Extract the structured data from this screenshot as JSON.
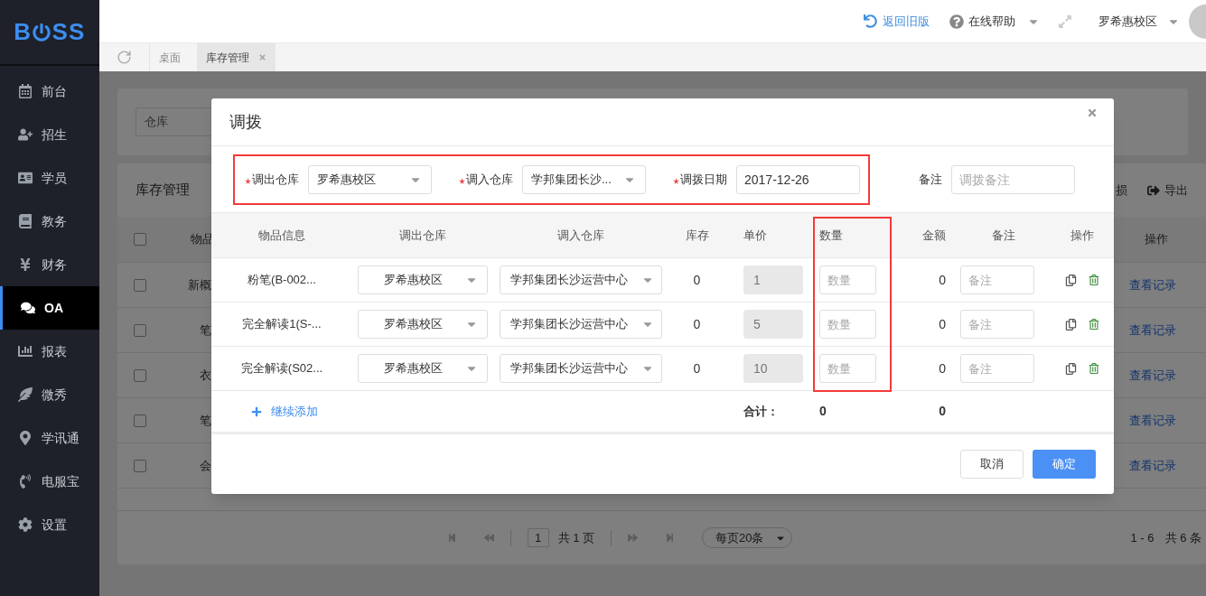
{
  "logo": {
    "before": "B",
    "after": "SS"
  },
  "sidebar": {
    "items": [
      {
        "label": "前台",
        "selected": false
      },
      {
        "label": "招生",
        "selected": false
      },
      {
        "label": "学员",
        "selected": false
      },
      {
        "label": "教务",
        "selected": false
      },
      {
        "label": "财务",
        "selected": false
      },
      {
        "label": "OA",
        "selected": true
      },
      {
        "label": "报表",
        "selected": false
      },
      {
        "label": "微秀",
        "selected": false
      },
      {
        "label": "学讯通",
        "selected": false
      },
      {
        "label": "电服宝",
        "selected": false
      },
      {
        "label": "设置",
        "selected": false
      }
    ]
  },
  "header": {
    "back_link": "返回旧版",
    "help": "在线帮助",
    "campus": "罗希惠校区"
  },
  "tabs": [
    {
      "label": "桌面",
      "selected": false,
      "closable": false
    },
    {
      "label": "库存管理",
      "selected": true,
      "closable": true
    }
  ],
  "filter": {
    "warehouse_placeholder": "仓库"
  },
  "inventory": {
    "title": "库存管理",
    "actions": [
      "损",
      "导出"
    ],
    "columns": [
      "物品",
      "操作"
    ],
    "all_checked": false,
    "rows": [
      {
        "checked": false,
        "name": "新概",
        "link": "查看记录"
      },
      {
        "checked": false,
        "name": "笔",
        "link": "查看记录"
      },
      {
        "checked": false,
        "name": "衣",
        "link": "查看记录"
      },
      {
        "checked": false,
        "name": "笔",
        "link": "查看记录"
      },
      {
        "checked": false,
        "name": "会",
        "link": "查看记录"
      }
    ],
    "pagination": {
      "page": "1",
      "pages": "共 1 页",
      "page_size": "每页20条",
      "range": "1 - 6",
      "total": "共 6 条"
    }
  },
  "dialog": {
    "title": "调拨",
    "form": {
      "highlighted": true,
      "fields": [
        {
          "kind": "select",
          "label": "调出仓库",
          "required": true,
          "value": "罗希惠校区"
        },
        {
          "kind": "select",
          "label": "调入仓库",
          "required": true,
          "value": "学邦集团长沙..."
        },
        {
          "kind": "input",
          "label": "调拨日期",
          "required": true,
          "value": "2017-12-26"
        },
        {
          "kind": "input",
          "label": "备注",
          "required": false,
          "placeholder": "调拨备注"
        }
      ]
    },
    "columns": [
      "物品信息",
      "调出仓库",
      "调入仓库",
      "库存",
      "单价",
      "数量",
      "金额",
      "备注",
      "操作"
    ],
    "quantity_column_highlighted": true,
    "rows": [
      {
        "item": "粉笔(B-002...",
        "from": "罗希惠校区",
        "to": "学邦集团长沙运营中心",
        "stock": "0",
        "price": "1",
        "price_disabled": true,
        "qty_placeholder": "数量",
        "amount": "0",
        "note_placeholder": "备注"
      },
      {
        "item": "完全解读1(S-...",
        "from": "罗希惠校区",
        "to": "学邦集团长沙运营中心",
        "stock": "0",
        "price": "5",
        "price_disabled": true,
        "qty_placeholder": "数量",
        "amount": "0",
        "note_placeholder": "备注"
      },
      {
        "item": "完全解读(S02...",
        "from": "罗希惠校区",
        "to": "学邦集团长沙运营中心",
        "stock": "0",
        "price": "10",
        "price_disabled": true,
        "qty_placeholder": "数量",
        "amount": "0",
        "note_placeholder": "备注"
      }
    ],
    "add_row": "继续添加",
    "total_label": "合计：",
    "total_qty": "0",
    "total_amount": "0",
    "buttons": {
      "cancel": "取消",
      "confirm": "确定"
    }
  }
}
